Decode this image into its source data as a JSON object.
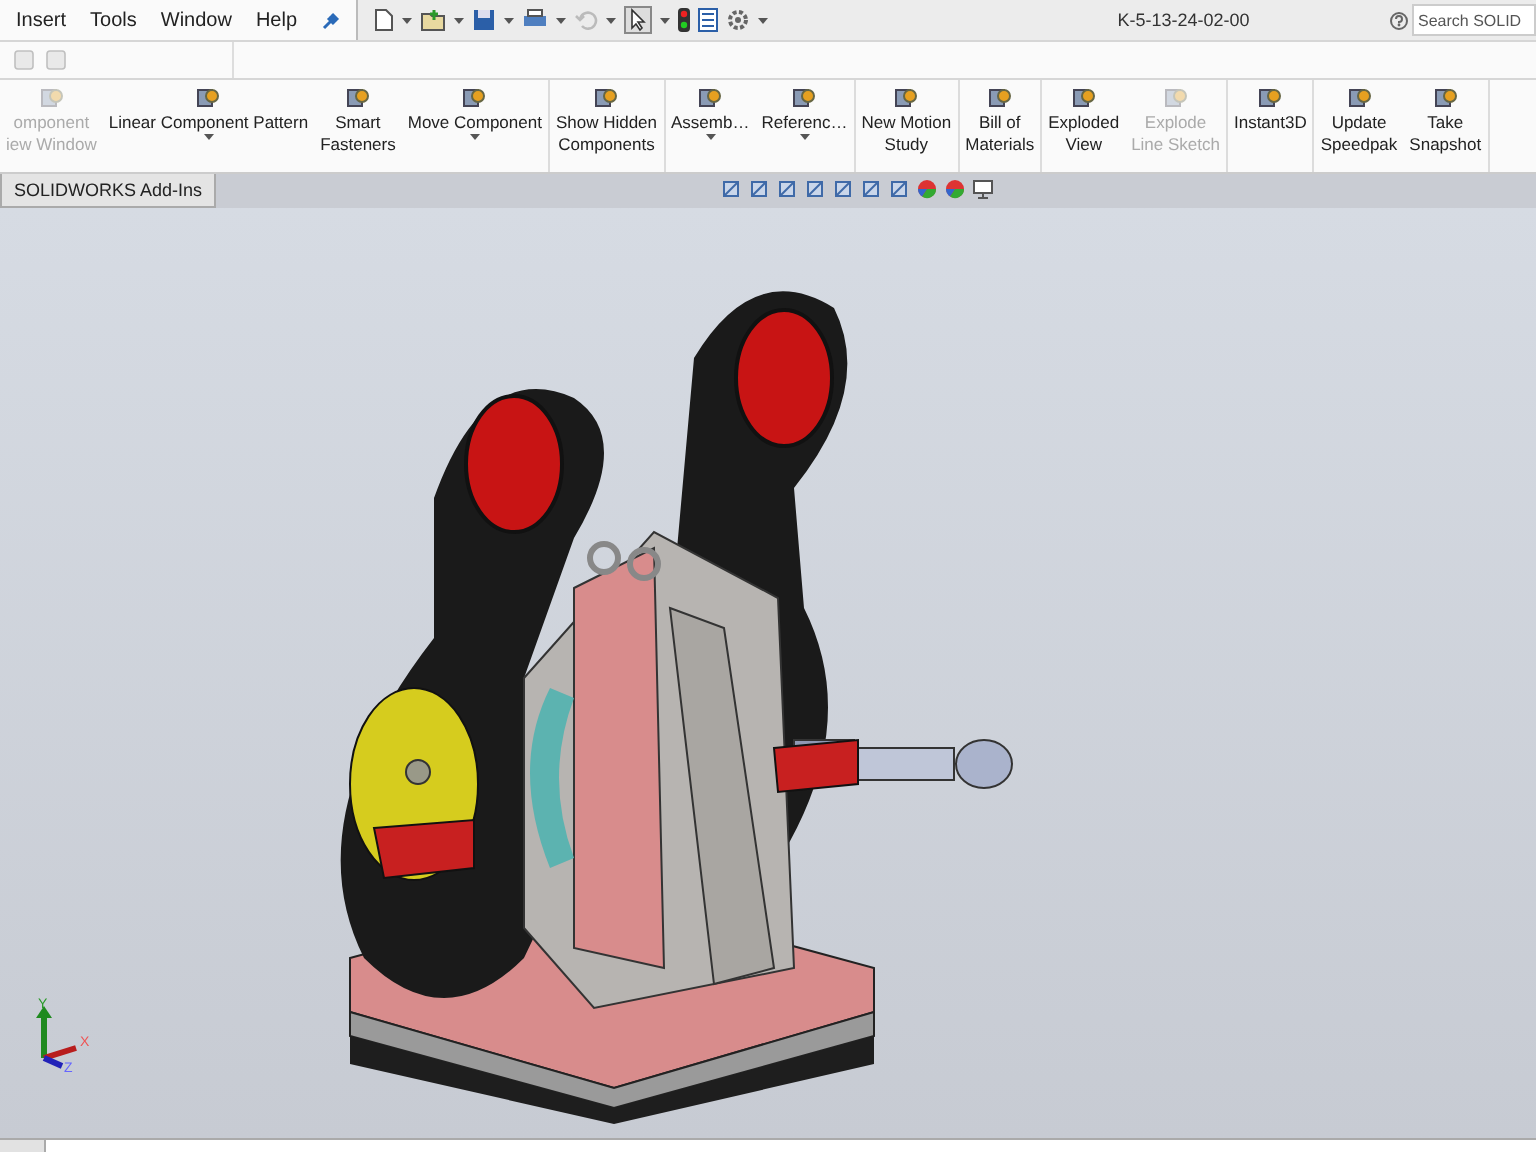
{
  "menu": [
    "Insert",
    "Tools",
    "Window",
    "Help"
  ],
  "title": "K-5-13-24-02-00",
  "search": {
    "placeholder": "Search SOLID"
  },
  "ribbon": [
    {
      "items": [
        {
          "lines": [
            "omponent",
            "iew Window"
          ],
          "disabled": true,
          "dropdown": false
        },
        {
          "lines": [
            "Linear Component Pattern"
          ],
          "disabled": false,
          "dropdown": true
        },
        {
          "lines": [
            "Smart",
            "Fasteners"
          ],
          "disabled": false,
          "dropdown": false
        },
        {
          "lines": [
            "Move Component"
          ],
          "disabled": false,
          "dropdown": true
        }
      ]
    },
    {
      "items": [
        {
          "lines": [
            "Show Hidden",
            "Components"
          ],
          "disabled": false,
          "dropdown": false
        }
      ]
    },
    {
      "items": [
        {
          "lines": [
            "Assemb…"
          ],
          "disabled": false,
          "dropdown": true
        },
        {
          "lines": [
            "Referenc…"
          ],
          "disabled": false,
          "dropdown": true
        }
      ]
    },
    {
      "items": [
        {
          "lines": [
            "New Motion",
            "Study"
          ],
          "disabled": false,
          "dropdown": false
        }
      ]
    },
    {
      "items": [
        {
          "lines": [
            "Bill of",
            "Materials"
          ],
          "disabled": false,
          "dropdown": false
        }
      ]
    },
    {
      "items": [
        {
          "lines": [
            "Exploded",
            "View"
          ],
          "disabled": false,
          "dropdown": false
        },
        {
          "lines": [
            "Explode",
            "Line Sketch"
          ],
          "disabled": true,
          "dropdown": false
        }
      ]
    },
    {
      "items": [
        {
          "lines": [
            "Instant3D"
          ],
          "disabled": false,
          "dropdown": false
        }
      ]
    },
    {
      "items": [
        {
          "lines": [
            "Update",
            "Speedpak"
          ],
          "disabled": false,
          "dropdown": false
        },
        {
          "lines": [
            "Take",
            "Snapshot"
          ],
          "disabled": false,
          "dropdown": false
        }
      ]
    }
  ],
  "tabs": [
    {
      "label": "SOLIDWORKS Add-Ins",
      "selected": false
    }
  ],
  "triad": {
    "y": "Y",
    "x": "X",
    "z": "Z"
  }
}
